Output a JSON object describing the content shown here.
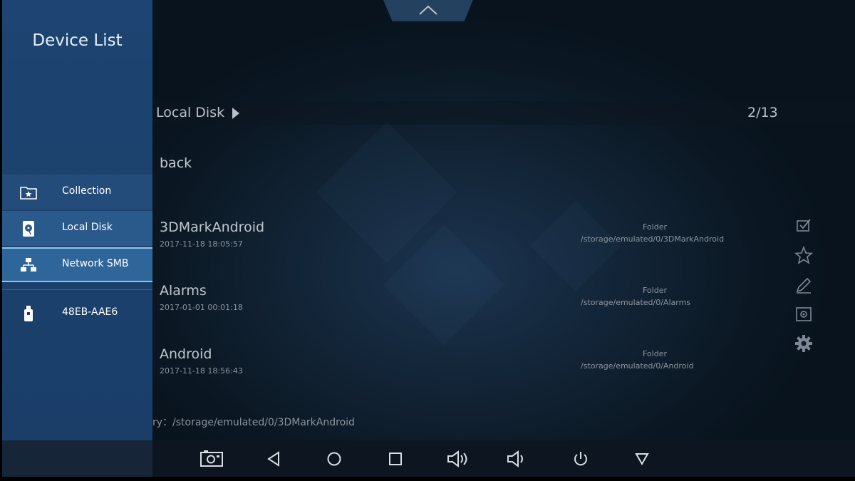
{
  "sidebar": {
    "title": "Device List",
    "items": [
      {
        "label": "Collection",
        "icon": "folder-star-icon"
      },
      {
        "label": "Local Disk",
        "icon": "hard-disk-icon"
      },
      {
        "label": "Network SMB",
        "icon": "network-icon"
      },
      {
        "label": "48EB-AAE6",
        "icon": "usb-drive-icon"
      }
    ],
    "selected": "Network SMB"
  },
  "path_bar": {
    "title": "Local Disk",
    "page": "2/13"
  },
  "list": {
    "back_label": "back",
    "files": [
      {
        "name": "3DMarkAndroid",
        "date": "2017-11-18 18:05:57",
        "type": "Folder",
        "path": "/storage/emulated/0/3DMarkAndroid"
      },
      {
        "name": "Alarms",
        "date": "2017-01-01 00:01:18",
        "type": "Folder",
        "path": "/storage/emulated/0/Alarms"
      },
      {
        "name": "Android",
        "date": "2017-11-18 18:56:43",
        "type": "Folder",
        "path": "/storage/emulated/0/Android"
      }
    ]
  },
  "status": {
    "text": "ry：/storage/emulated/0/3DMarkAndroid"
  },
  "tools": [
    "multi-select-icon",
    "star-icon",
    "edit-icon",
    "preview-icon",
    "gear-icon"
  ],
  "system_nav": [
    "screenshot-icon",
    "back-icon",
    "home-icon",
    "recents-icon",
    "volume-up-icon",
    "volume-down-icon",
    "power-icon",
    "dropdown-icon"
  ],
  "colors": {
    "sidebar": "#1d4472",
    "selected_item": "#2f6699",
    "selected_border": "#8fc4f0",
    "background": "#0b1824"
  }
}
